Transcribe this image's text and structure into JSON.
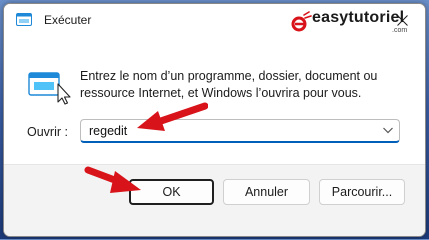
{
  "window": {
    "title": "Exécuter"
  },
  "watermark": {
    "text": "easytutoriel",
    "sub": ".com"
  },
  "description": {
    "line1": "Entrez le nom d’un programme, dossier, document ou",
    "line2": "ressource Internet, et Windows l’ouvrira pour vous."
  },
  "open_field": {
    "label": "Ouvrir :",
    "value": "regedit"
  },
  "buttons": {
    "ok": "OK",
    "cancel": "Annuler",
    "browse": "Parcourir..."
  },
  "colors": {
    "accent": "#005fb8",
    "arrow": "#d8141a",
    "icon_blue": "#1e88d9"
  },
  "icons": [
    "run-app-icon",
    "close-icon",
    "chevron-down-icon",
    "run-program-icon"
  ]
}
